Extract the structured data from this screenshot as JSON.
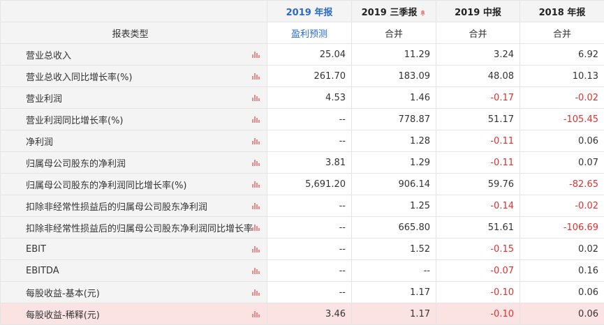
{
  "header": {
    "columns": [
      "",
      "2019 年报",
      "2019 三季报",
      "2019 中报",
      "2018 年报"
    ],
    "highlight_index": 1,
    "bell_index": 2
  },
  "type_row": {
    "label": "报表类型",
    "values": [
      "盈利预测",
      "合并",
      "合并",
      "合并"
    ]
  },
  "rows": [
    {
      "label": "营业总收入",
      "values": [
        "25.04",
        "11.29",
        "3.24",
        "6.92"
      ]
    },
    {
      "label": "营业总收入同比增长率(%)",
      "values": [
        "261.70",
        "183.09",
        "48.08",
        "10.13"
      ]
    },
    {
      "label": "营业利润",
      "values": [
        "4.53",
        "1.46",
        "-0.17",
        "-0.02"
      ]
    },
    {
      "label": "营业利润同比增长率(%)",
      "values": [
        "--",
        "778.87",
        "51.17",
        "-105.45"
      ]
    },
    {
      "label": "净利润",
      "values": [
        "--",
        "1.28",
        "-0.11",
        "0.06"
      ]
    },
    {
      "label": "归属母公司股东的净利润",
      "values": [
        "3.81",
        "1.29",
        "-0.11",
        "0.07"
      ]
    },
    {
      "label": "归属母公司股东的净利润同比增长率(%)",
      "values": [
        "5,691.20",
        "906.14",
        "59.76",
        "-82.65"
      ]
    },
    {
      "label": "扣除非经常性损益后的归属母公司股东净利润",
      "values": [
        "--",
        "1.25",
        "-0.14",
        "-0.02"
      ]
    },
    {
      "label": "扣除非经常性损益后的归属母公司股东净利润同比增长率",
      "values": [
        "--",
        "665.80",
        "51.61",
        "-106.69"
      ]
    },
    {
      "label": "EBIT",
      "values": [
        "--",
        "1.52",
        "-0.15",
        "0.02"
      ]
    },
    {
      "label": "EBITDA",
      "values": [
        "--",
        "--",
        "-0.07",
        "0.16"
      ]
    },
    {
      "label": "每股收益-基本(元)",
      "values": [
        "--",
        "1.17",
        "-0.10",
        "0.06"
      ]
    },
    {
      "label": "每股收益-稀释(元)",
      "values": [
        "3.46",
        "1.17",
        "-0.10",
        "0.06"
      ]
    }
  ],
  "hover_row_index": 12,
  "icons": {
    "row_chart": "bar-chart-icon",
    "bell": "bell-icon"
  },
  "colors": {
    "accent_blue": "#2a6ac8",
    "negative_red": "#e0312f",
    "icon_pink": "#e98a8a",
    "hover_row": "#fbe3e3"
  }
}
